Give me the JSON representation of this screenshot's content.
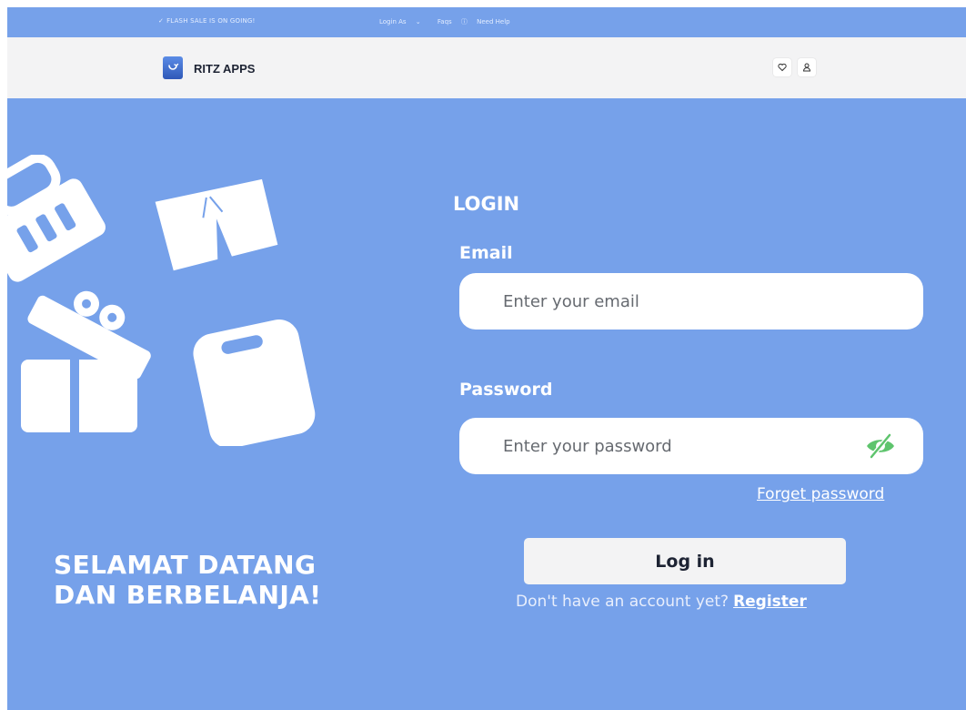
{
  "topbar": {
    "notice": "FLASH SALE IS ON GOING!",
    "links": [
      "Login As",
      "Faqs",
      "Need Help"
    ]
  },
  "header": {
    "brand": "RITZ APPS",
    "icons": [
      "heart-icon",
      "user-icon"
    ]
  },
  "hero": {
    "welcome_line1": "SELAMAT DATANG",
    "welcome_line2": "DAN BERBELANJA!"
  },
  "login": {
    "title": "LOGIN",
    "email_label": "Email",
    "email_placeholder": "Enter your email",
    "password_label": "Password",
    "password_placeholder": "Enter your password",
    "forget_password": "Forget password",
    "login_button": "Log in",
    "no_account_text": "Don't have an account yet?",
    "register_link": "Register"
  },
  "colors": {
    "primary_blue": "#76a1ea",
    "header_bg": "#f3f3f4",
    "eye_icon_green": "#5ec46d"
  }
}
